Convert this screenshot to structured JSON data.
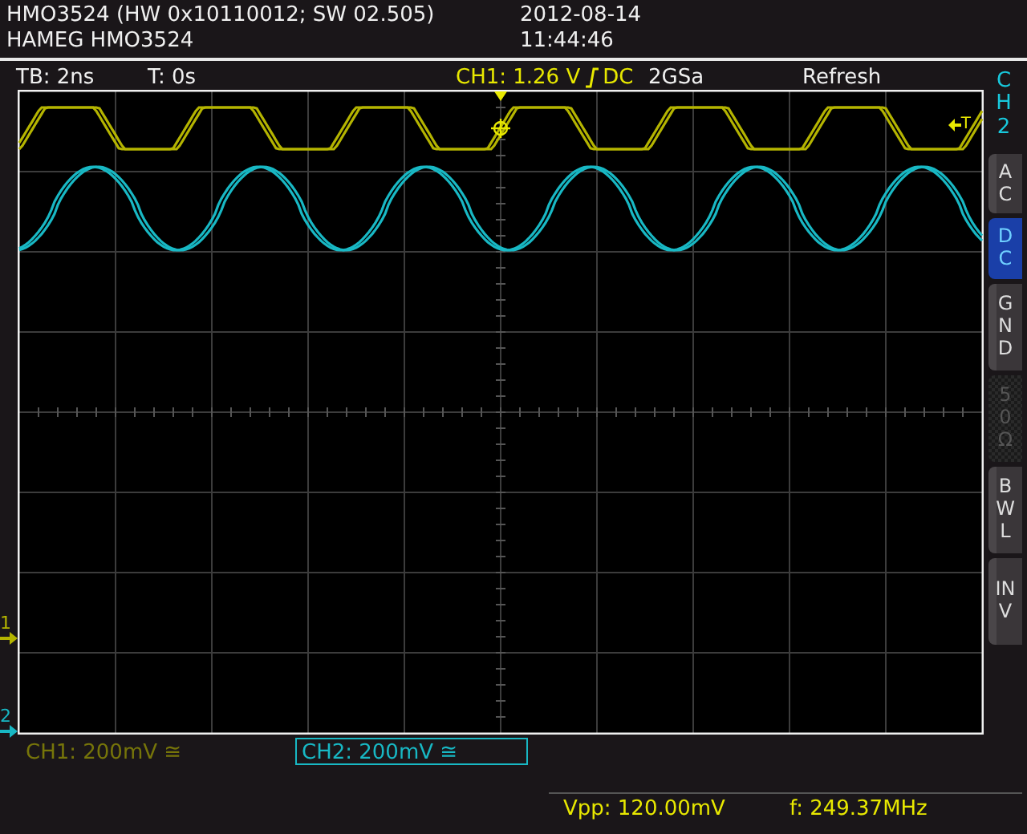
{
  "header": {
    "model_info": "HMO3524 (HW 0x10110012; SW 02.505)",
    "device_name": "HAMEG HMO3524",
    "date": "2012-08-14",
    "time": "11:44:46"
  },
  "info_bar": {
    "timebase": "TB: 2ns",
    "trigger_time": "T: 0s",
    "trigger_level": "CH1: 1.26 V",
    "trigger_coupling": "DC",
    "sample_rate": "2GSa",
    "mode": "Refresh"
  },
  "trigger_marker": "T",
  "channels": [
    {
      "label": "CH1: 200mV ≅",
      "marker": "1",
      "color": "#b4b400",
      "selected": false
    },
    {
      "label": "CH2: 200mV ≅",
      "marker": "2",
      "color": "#18b8c4",
      "selected": true
    }
  ],
  "side_menu": {
    "title": "CH2",
    "buttons": [
      {
        "label": "AC",
        "selected": false,
        "disabled": false
      },
      {
        "label": "DC",
        "selected": true,
        "disabled": false
      },
      {
        "label": "GND",
        "selected": false,
        "disabled": false
      },
      {
        "label": "50Ω",
        "selected": false,
        "disabled": true
      },
      {
        "label": "BWL",
        "selected": false,
        "disabled": false
      },
      {
        "label": "INV",
        "selected": false,
        "disabled": false
      }
    ]
  },
  "measurements": [
    {
      "label": "Vpp: 120.00mV"
    },
    {
      "label": "f: 249.37MHz"
    }
  ]
}
